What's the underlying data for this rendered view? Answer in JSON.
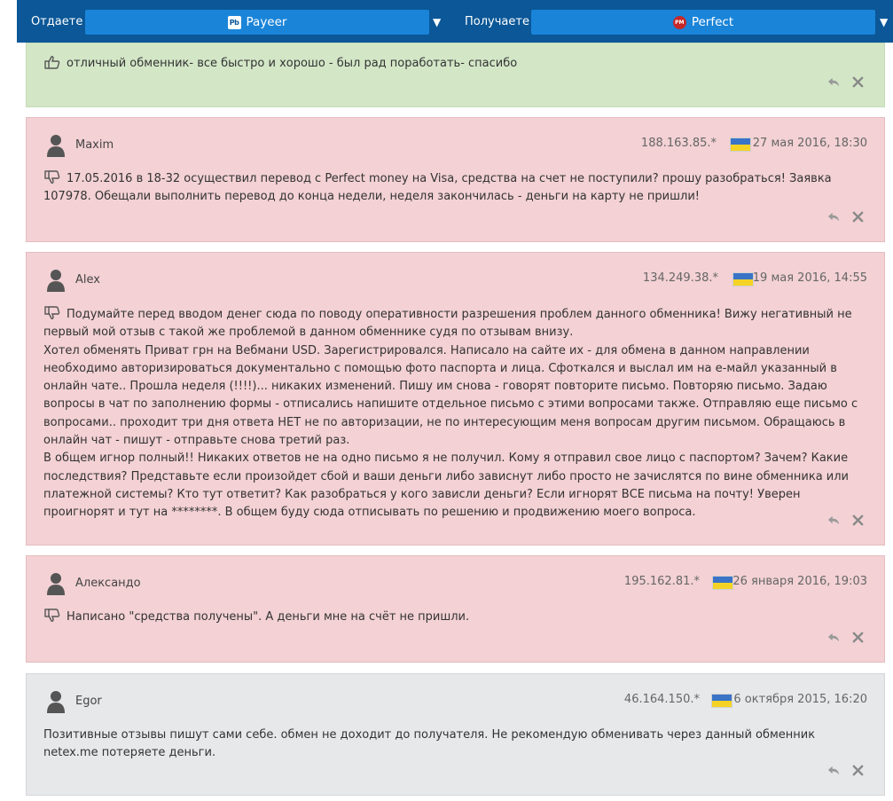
{
  "exchange_bar": {
    "give_label": "Отдаете",
    "give_value": "Payeer",
    "give_logo": "Pb",
    "get_label": "Получаете",
    "get_value": "Perfect",
    "get_logo": "PM"
  },
  "reviews": [
    {
      "type": "positive",
      "text": "отличный обменник- все быстро и хорошо - был рад поработать- спасибо"
    },
    {
      "type": "negative",
      "author": "Maxim",
      "ip": "188.163.85.*",
      "date": "27 мая 2016, 18:30",
      "text": "17.05.2016 в 18-32 осуществил перевод с Perfect money на Visa, средства на счет не поступили? прошу разобраться! Заявка 107978. Обещали выполнить перевод до конца недели, неделя закончилась - деньги на карту не пришли!"
    },
    {
      "type": "negative",
      "author": "Alex",
      "ip": "134.249.38.*",
      "date": "19 мая 2016, 14:55",
      "text": "Подумайте перед вводом денег сюда по поводу оперативности разрешения проблем данного обменника! Вижу негативный не первый мой отзыв с такой же проблемой в данном обменнике судя по отзывам внизу.\nХотел обменять Приват грн на Вебмани USD. Зарегистрировался. Написало на сайте их - для обмена в данном направлении необходимо авторизироваться документально с помощью фото паспорта и лица. Сфоткался и выслал им на e-майл указанный в онлайн чате.. Прошла неделя (!!!!)... никаких изменений. Пишу им снова - говорят повторите письмо. Повторяю письмо. Задаю вопросы в чат по заполнению формы - отписались напишите отдельное письмо с этими вопросами также. Отправляю еще письмо с вопросами.. проходит три дня ответа НЕТ не по авторизации, не по интересующим меня вопросам другим письмом. Обращаюсь в онлайн чат - пишут - отправьте снова третий раз.\nВ общем игнор полный!! Никаких ответов не на одно письмо я не получил. Кому я отправил свое лицо с паспортом? Зачем? Какие последствия? Представьте если произойдет сбой и ваши деньги либо зависнут либо просто не зачислятся по вине обменника или платежной системы? Кто тут ответит? Как разобраться у кого зависли деньги? Если игнорят ВСЕ письма на почту! Уверен проигнорят и тут на ********. В общем буду сюда отписывать по решению и продвижению моего вопроса."
    },
    {
      "type": "negative",
      "author": "Александо",
      "ip": "195.162.81.*",
      "date": "26 января 2016, 19:03",
      "text": "Написано \"средства получены\". А деньги мне на счёт не пришли."
    },
    {
      "type": "neutral",
      "author": "Egor",
      "ip": "46.164.150.*",
      "date": "6 октября 2015, 16:20",
      "text": "Позитивные отзывы пишут сами себе. обмен не доходит до получателя. Не рекомендую обменивать через данный обменник netex.me потеряете деньги."
    }
  ],
  "icons": {
    "avatar": "user-icon",
    "reply": "reply-icon",
    "close": "close-icon",
    "like": "thumbs-up-icon",
    "dislike": "thumbs-down-icon",
    "flag": "ukraine-flag-icon"
  },
  "colors": {
    "topbar": "#0b5797",
    "select": "#1a84d8",
    "positive_bg": "#d3e7c7",
    "negative_bg": "#f3d1d4",
    "neutral_bg": "#e7e8ea"
  }
}
